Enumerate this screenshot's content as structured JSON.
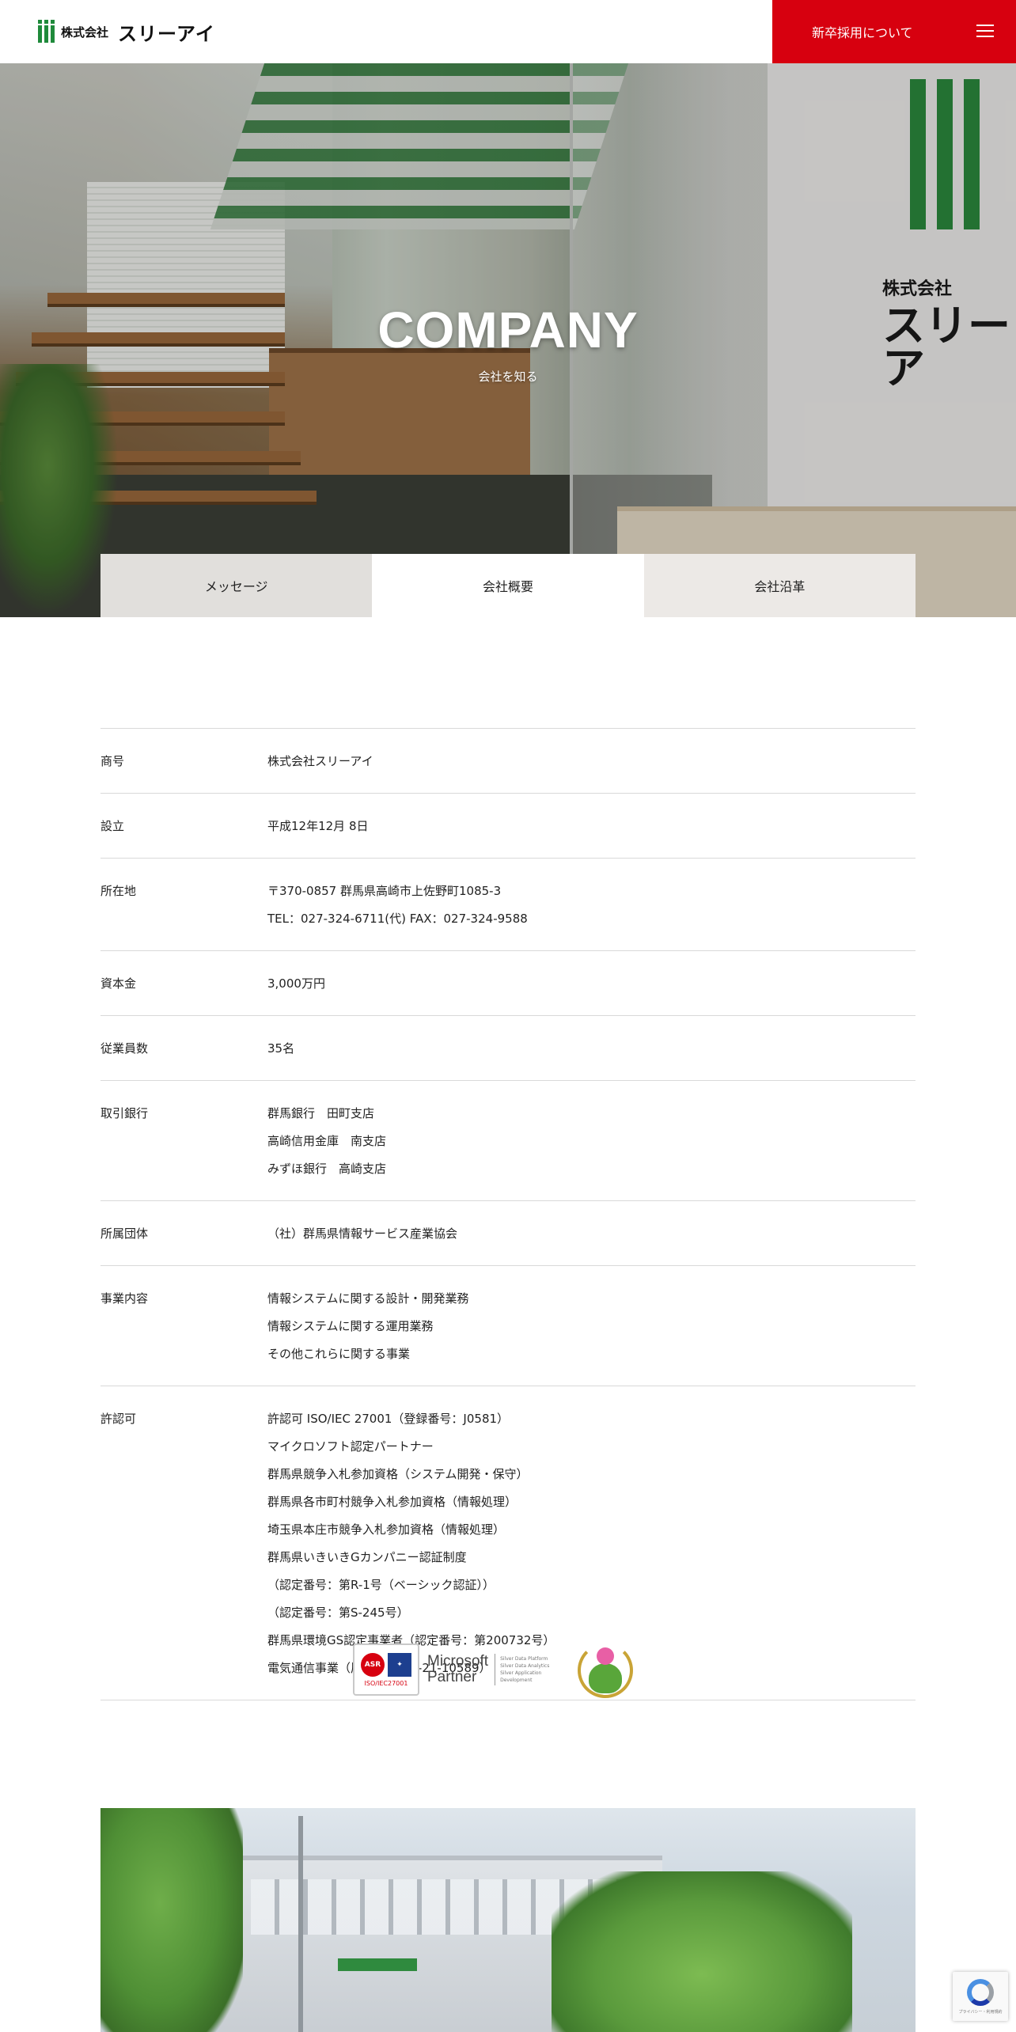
{
  "header": {
    "logo_small": "株式会社",
    "logo_big": "スリーアイ",
    "recruit_label": "新卒採用について"
  },
  "hero": {
    "title": "COMPANY",
    "subtitle": "会社を知る",
    "sign_small": "株式会社",
    "sign_big": "スリーア"
  },
  "tabs": [
    {
      "label": "メッセージ"
    },
    {
      "label": "会社概要"
    },
    {
      "label": "会社沿革"
    }
  ],
  "info": [
    {
      "label": "商号",
      "values": [
        "株式会社スリーアイ"
      ]
    },
    {
      "label": "設立",
      "values": [
        "平成12年12月 8日"
      ]
    },
    {
      "label": "所在地",
      "values": [
        "〒370-0857 群馬県高崎市上佐野町1085-3",
        "TEL：027-324-6711(代) FAX：027-324-9588"
      ]
    },
    {
      "label": "資本金",
      "values": [
        "3,000万円"
      ]
    },
    {
      "label": "従業員数",
      "values": [
        "35名"
      ]
    },
    {
      "label": "取引銀行",
      "values": [
        "群馬銀行　田町支店",
        "高崎信用金庫　南支店",
        "みずほ銀行　高崎支店"
      ]
    },
    {
      "label": "所属団体",
      "values": [
        "（社）群馬県情報サービス産業協会"
      ]
    },
    {
      "label": "事業内容",
      "values": [
        "情報システムに関する設計・開発業務",
        "情報システムに関する運用業務",
        "その他これらに関する事業"
      ]
    },
    {
      "label": "許認可",
      "values": [
        "許認可 ISO/IEC 27001（登録番号：J0581）",
        "マイクロソフト認定パートナー",
        "群馬県競争入札参加資格（システム開発・保守）",
        "群馬県各市町村競争入札参加資格（情報処理）",
        "埼玉県本庄市競争入札参加資格（情報処理）",
        "群馬県いきいきGカンパニー認証制度",
        "（認定番号：第R-1号（ベーシック認証））",
        "（認定番号：第S-245号）",
        "群馬県環境GS認定事業者（認定番号：第200732号）",
        "電気通信事業（届出番号：A-21-10589）"
      ]
    }
  ],
  "certs": {
    "iso_badge1": "ASR",
    "iso_caption": "ISO/IEC27001",
    "ms_line1": "Microsoft",
    "ms_line2": "Partner",
    "ms_items": [
      "Silver Data Platform",
      "Silver Data Analytics",
      "Silver Application Development"
    ]
  },
  "recaptcha": {
    "text": "プライバシー・利用規約"
  },
  "colors": {
    "brand_red": "#d7000f",
    "brand_green": "#1f8a3b"
  },
  "icons": {
    "menu": "hamburger-menu-icon",
    "logo": "iii-logo-icon"
  }
}
